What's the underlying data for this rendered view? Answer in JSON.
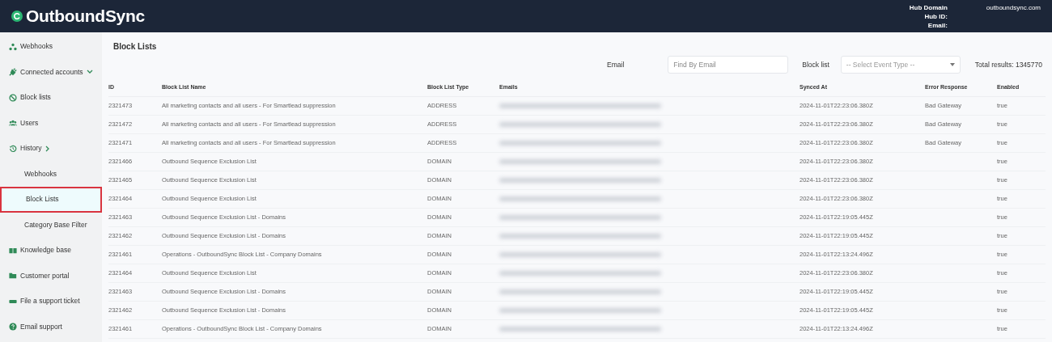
{
  "header": {
    "logo": "OutboundSync",
    "hub_domain_label": "Hub Domain",
    "hub_domain": "outboundsync.com",
    "hub_id_label": "Hub ID:",
    "email_label": "Email:"
  },
  "sidebar": {
    "items": [
      {
        "label": "Webhooks",
        "selected": false
      },
      {
        "label": "Connected accounts",
        "expanded": true,
        "selected": false
      },
      {
        "label": "Block lists",
        "selected": false
      },
      {
        "label": "Users",
        "selected": false
      },
      {
        "label": "History",
        "expanded": false,
        "selected": false,
        "children": [
          {
            "label": "Webhooks",
            "selected": false
          },
          {
            "label": "Block Lists",
            "selected": true
          },
          {
            "label": "Category Base Filter",
            "selected": false
          }
        ]
      },
      {
        "label": "Knowledge base",
        "selected": false
      },
      {
        "label": "Customer portal",
        "selected": false
      },
      {
        "label": "File a support ticket",
        "selected": false
      },
      {
        "label": "Email support",
        "selected": false
      }
    ]
  },
  "page_title": "Block Lists",
  "filters": {
    "email_label": "Email",
    "email_placeholder": "Find By Email",
    "block_list_label": "Block list",
    "block_list_placeholder": "-- Select Event Type --",
    "total": "Total results: 1345770"
  },
  "table": {
    "columns": [
      "ID",
      "Block List Name",
      "Block List Type",
      "Emails",
      "Synced At",
      "Error Response",
      "Enabled"
    ],
    "rows": [
      {
        "id": "2321473",
        "name": "All marketing contacts and all users - For Smartlead suppression",
        "type": "ADDRESS",
        "synced_at": "2024-11-01T22:23:06.380Z",
        "error": "Bad Gateway",
        "enabled": "true"
      },
      {
        "id": "2321472",
        "name": "All marketing contacts and all users - For Smartlead suppression",
        "type": "ADDRESS",
        "synced_at": "2024-11-01T22:23:06.380Z",
        "error": "Bad Gateway",
        "enabled": "true"
      },
      {
        "id": "2321471",
        "name": "All marketing contacts and all users - For Smartlead suppression",
        "type": "ADDRESS",
        "synced_at": "2024-11-01T22:23:06.380Z",
        "error": "Bad Gateway",
        "enabled": "true"
      },
      {
        "id": "2321466",
        "name": "Outbound Sequence Exclusion List",
        "type": "DOMAIN",
        "synced_at": "2024-11-01T22:23:06.380Z",
        "enabled": "true"
      },
      {
        "id": "2321465",
        "name": "Outbound Sequence Exclusion List",
        "type": "DOMAIN",
        "synced_at": "2024-11-01T22:23:06.380Z",
        "enabled": "true"
      },
      {
        "id": "2321464",
        "name": "Outbound Sequence Exclusion List",
        "type": "DOMAIN",
        "synced_at": "2024-11-01T22:23:06.380Z",
        "enabled": "true"
      },
      {
        "id": "2321463",
        "name": "Outbound Sequence Exclusion List - Domains",
        "type": "DOMAIN",
        "synced_at": "2024-11-01T22:19:05.445Z",
        "enabled": "true"
      },
      {
        "id": "2321462",
        "name": "Outbound Sequence Exclusion List - Domains",
        "type": "DOMAIN",
        "synced_at": "2024-11-01T22:19:05.445Z",
        "enabled": "true"
      },
      {
        "id": "2321461",
        "name": "Operations - OutboundSync Block List - Company Domains",
        "type": "DOMAIN",
        "synced_at": "2024-11-01T22:13:24.496Z",
        "enabled": "true"
      },
      {
        "id": "2321464",
        "name": "Outbound Sequence Exclusion List",
        "type": "DOMAIN",
        "synced_at": "2024-11-01T22:23:06.380Z",
        "enabled": "true"
      },
      {
        "id": "2321463",
        "name": "Outbound Sequence Exclusion List - Domains",
        "type": "DOMAIN",
        "synced_at": "2024-11-01T22:19:05.445Z",
        "enabled": "true"
      },
      {
        "id": "2321462",
        "name": "Outbound Sequence Exclusion List - Domains",
        "type": "DOMAIN",
        "synced_at": "2024-11-01T22:19:05.445Z",
        "enabled": "true"
      },
      {
        "id": "2321461",
        "name": "Operations - OutboundSync Block List - Company Domains",
        "type": "DOMAIN",
        "synced_at": "2024-11-01T22:13:24.496Z",
        "enabled": "true"
      }
    ]
  }
}
